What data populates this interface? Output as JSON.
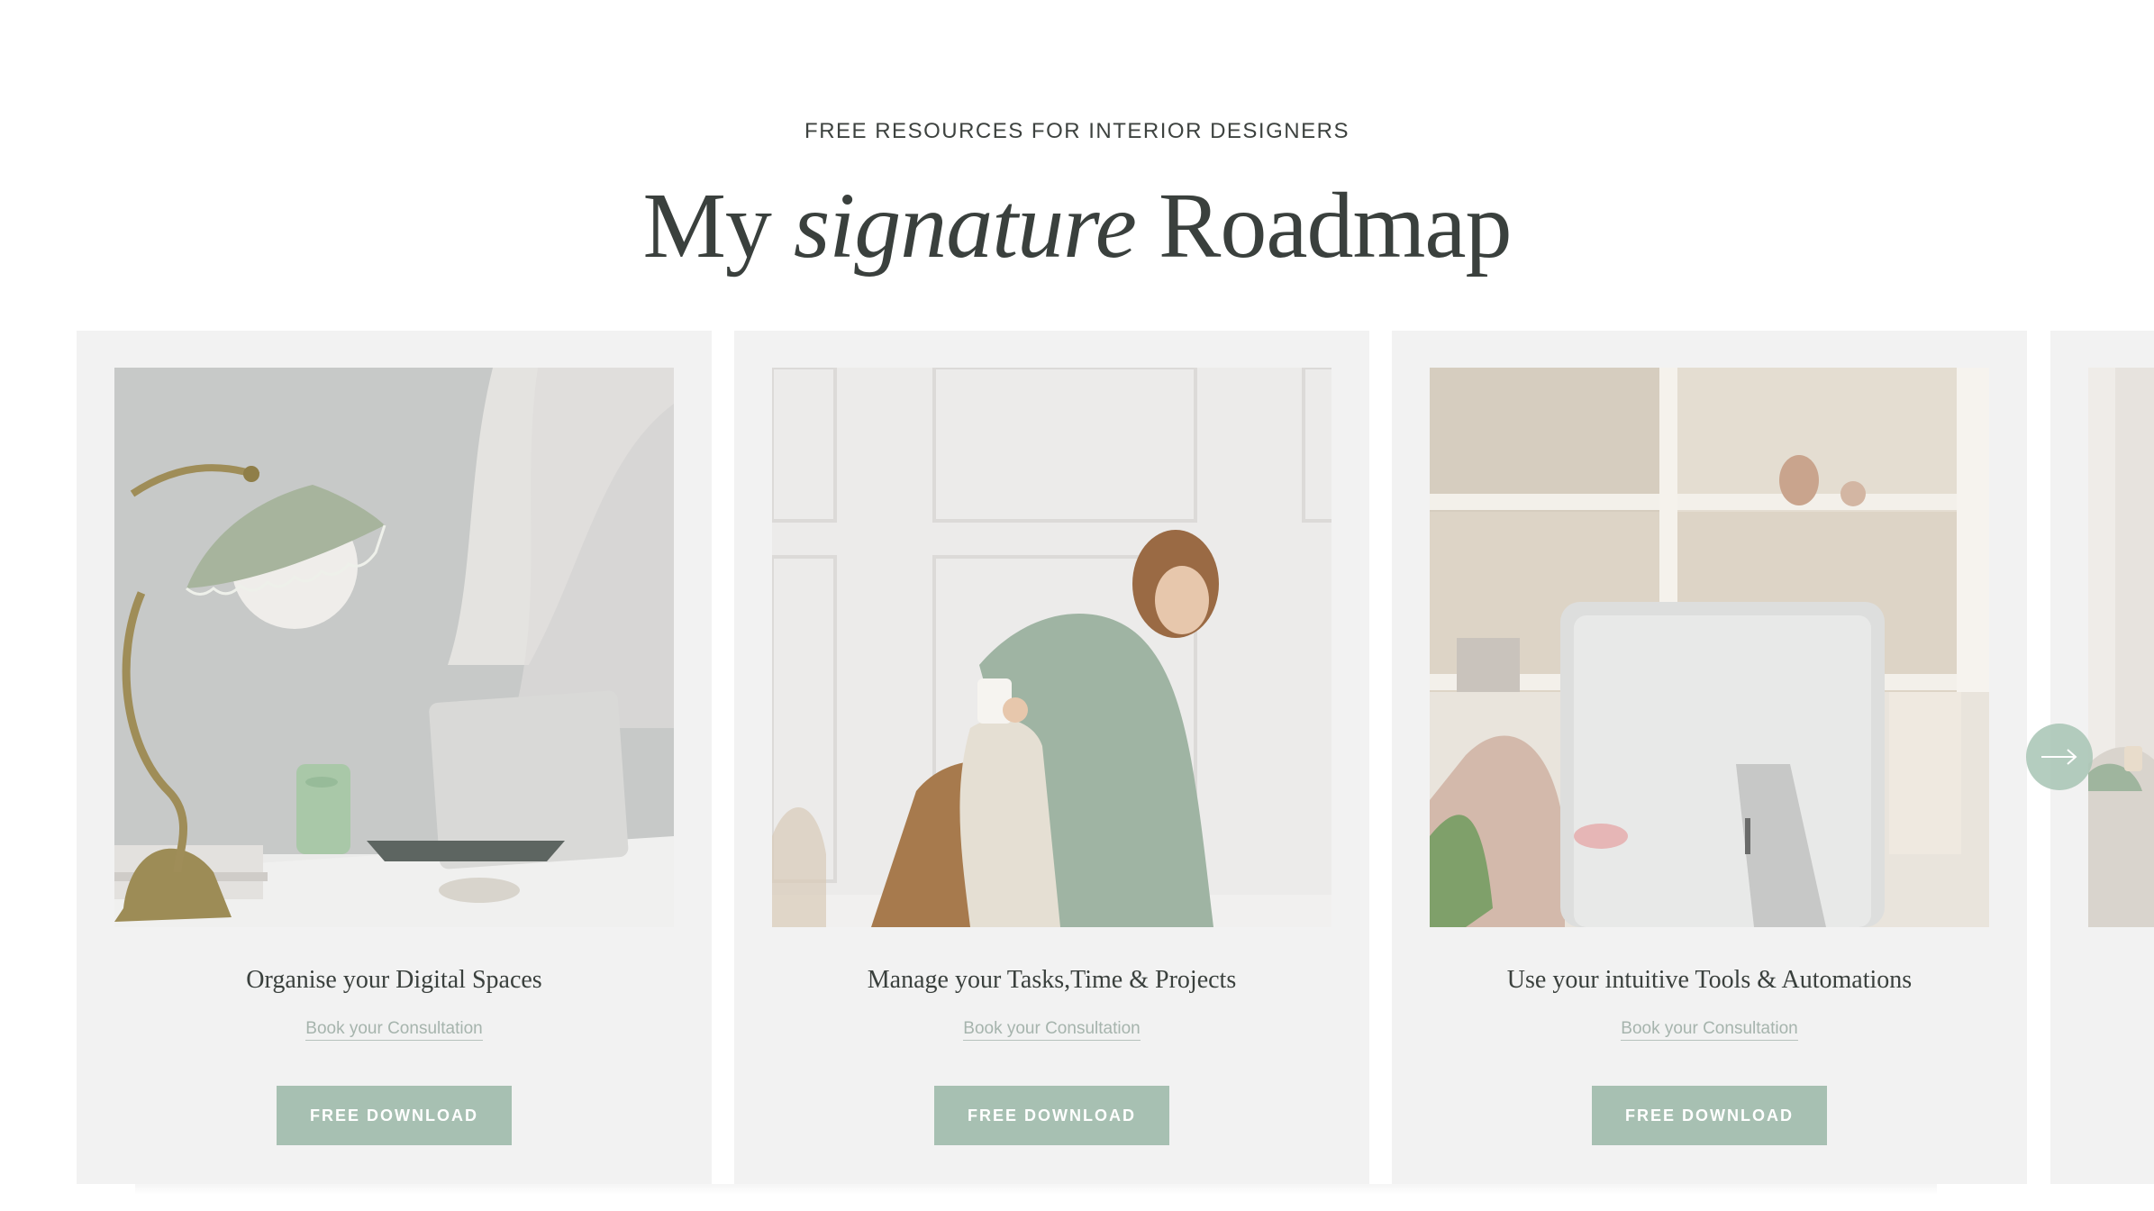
{
  "section": {
    "eyebrow": "FREE RESOURCES FOR INTERIOR DESIGNERS",
    "headline_start": "My",
    "headline_accent": "signature",
    "headline_end": "Roadmap"
  },
  "cards": [
    {
      "title": "Organise your Digital Spaces",
      "link": "Book your Consultation",
      "button": "FREE DOWNLOAD",
      "image": "desk-lamp-laptop-photo"
    },
    {
      "title": "Manage your Tasks,Time & Projects",
      "link": "Book your Consultation",
      "button": "FREE DOWNLOAD",
      "image": "woman-rattan-chair-photo"
    },
    {
      "title": "Use your intuitive Tools & Automations",
      "link": "Book your Consultation",
      "button": "FREE DOWNLOAD",
      "image": "desktop-computer-shelves-photo"
    }
  ],
  "carousel": {
    "next_icon": "arrow-right-icon"
  },
  "colors": {
    "accent": "#a7c0b2",
    "card_bg": "#f2f2f2",
    "heading": "#3a403d",
    "link": "#a6b4ad"
  }
}
